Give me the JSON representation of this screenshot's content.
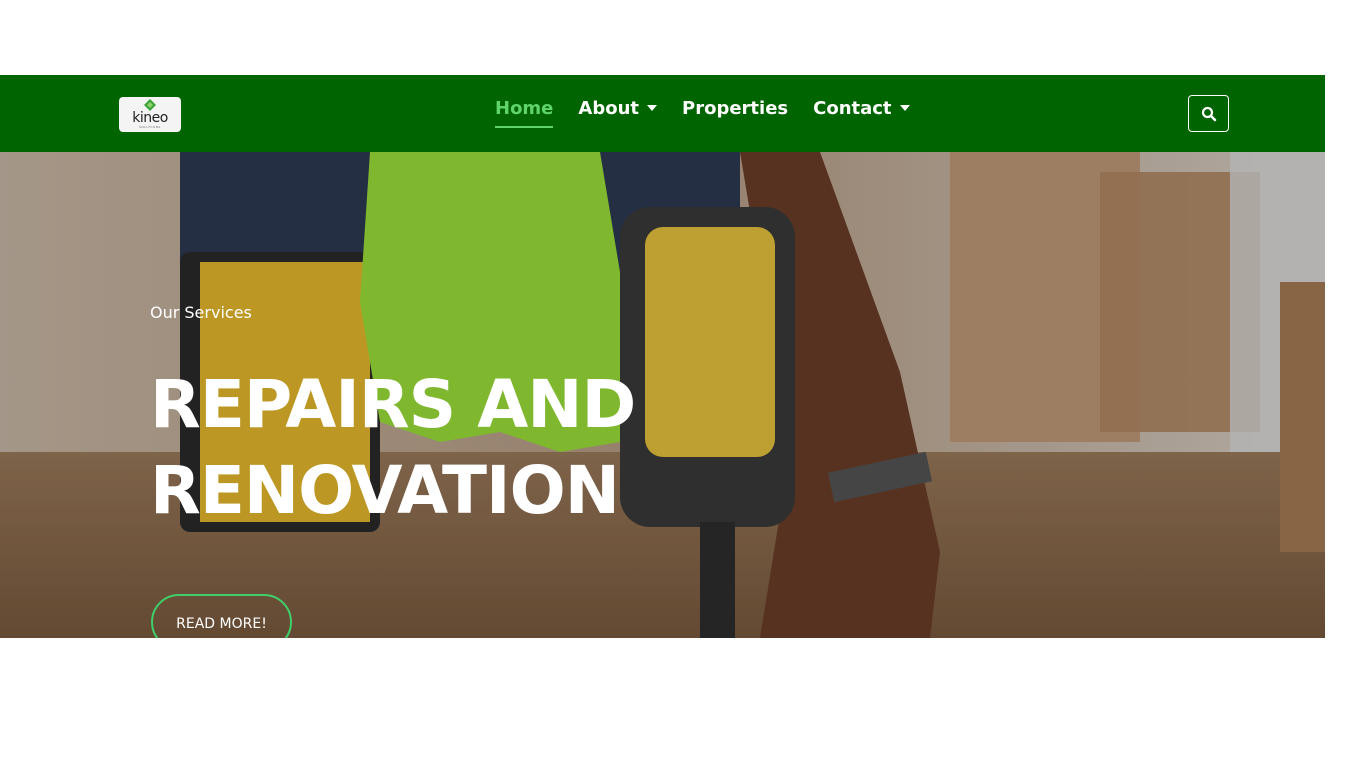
{
  "brand": {
    "name": "kineo",
    "tagline": "SOLUTIONS"
  },
  "nav": {
    "items": [
      {
        "label": "Home",
        "active": true,
        "dropdown": false
      },
      {
        "label": "About",
        "active": false,
        "dropdown": true
      },
      {
        "label": "Properties",
        "active": false,
        "dropdown": false
      },
      {
        "label": "Contact",
        "active": false,
        "dropdown": true
      }
    ],
    "search_icon": "search-icon"
  },
  "hero": {
    "subtitle": "Our Services",
    "title_line1": "REPAIRS AND",
    "title_line2": "RENOVATION",
    "cta_label": "READ MORE!"
  },
  "colors": {
    "navbar": "#006400",
    "accent": "#5fd46a",
    "cta_border": "#3ecf6a"
  }
}
